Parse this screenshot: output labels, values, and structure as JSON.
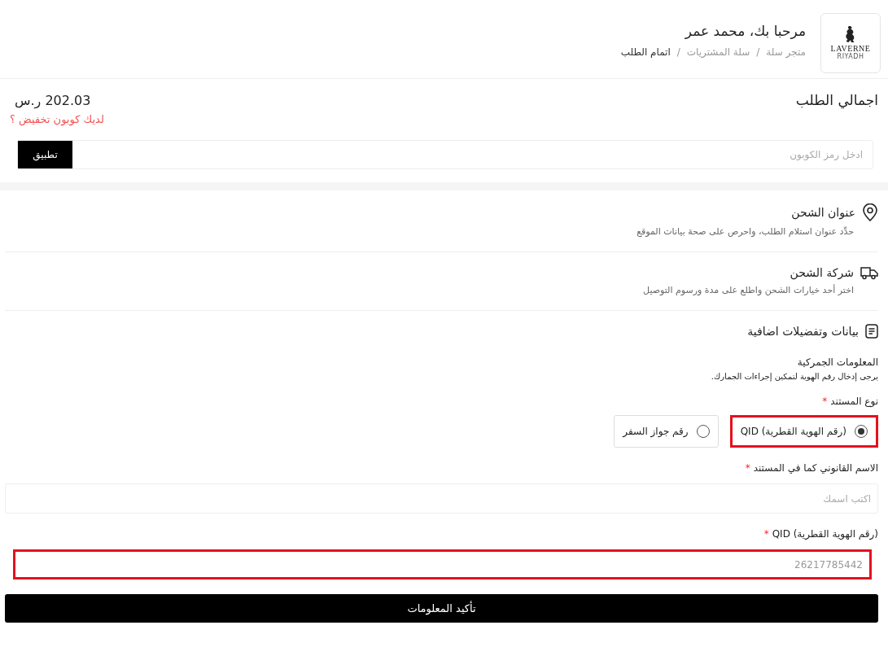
{
  "header": {
    "logo": {
      "name": "LAVERNE",
      "city": "RIYADH"
    },
    "greeting": "مرحبا بك، محمد عمر",
    "breadcrumbs": [
      {
        "label": "متجر سلة",
        "current": false
      },
      {
        "label": "سلة المشتريات",
        "current": false
      },
      {
        "label": "اتمام الطلب",
        "current": true
      }
    ],
    "separator": "/"
  },
  "summary": {
    "title": "اجمالي الطلب",
    "total": "202.03 ر.س",
    "coupon_link": "لديك كوبون تخفيض ؟",
    "coupon_field": {
      "placeholder": "ادخل رمز الكوبون"
    },
    "apply_button": "تطبيق"
  },
  "steps": [
    {
      "kind": "pin",
      "title": "عنوان الشحن",
      "description": "حدِّد عنوان استلام الطلب، واحرص على صحة بيانات الموقع"
    },
    {
      "kind": "truck",
      "title": "شركة الشحن",
      "description": "اختر أحد خيارات الشحن واطلع على مدة ورسوم التوصيل"
    }
  ],
  "details": {
    "title": "بيانات وتفضيلات اضافية",
    "customs_title": "المعلومات الجمركية",
    "customs_note": "يرجى إدخال رقم الهوية لتمكين إجراءات الجمارك.",
    "document_type": {
      "label": "نوع المستند",
      "required_mark": "*",
      "options": [
        {
          "label": "(رقم الهوية القطرية) QID",
          "selected": true,
          "highlighted": true
        },
        {
          "label": "رقم جواز السفر",
          "selected": false,
          "highlighted": false
        }
      ]
    },
    "legal_name": {
      "label": "الاسم القانوني كما في المستند",
      "required_mark": "*",
      "placeholder": "اكتب اسمك",
      "highlighted": false
    },
    "qid": {
      "label": "(رقم الهوية القطرية) QID",
      "required_mark": "*",
      "value": "26217785442",
      "highlighted": true
    },
    "confirm_button": "تأكيد المعلومات"
  }
}
